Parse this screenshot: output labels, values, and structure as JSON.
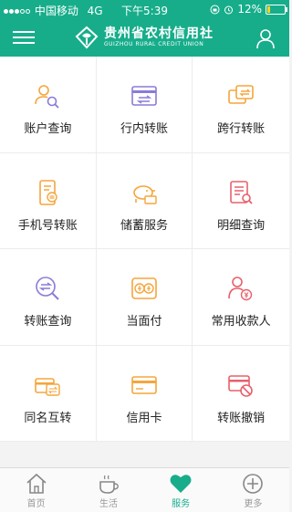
{
  "status_bar": {
    "carrier": "中国移动",
    "network": "4G",
    "time": "下午5:39",
    "battery": "12%"
  },
  "header": {
    "brand_cn": "贵州省农村信用社",
    "brand_en": "GUIZHOU RURAL CREDIT UNION"
  },
  "colors": {
    "primary": "#17ad8b",
    "orange": "#f5a53b",
    "purple": "#8a7bd8",
    "red": "#e8606c"
  },
  "services": [
    {
      "label": "账户查询",
      "icon": "account-search-icon"
    },
    {
      "label": "行内转账",
      "icon": "intra-transfer-icon"
    },
    {
      "label": "跨行转账",
      "icon": "inter-transfer-icon"
    },
    {
      "label": "手机号转账",
      "icon": "phone-transfer-icon"
    },
    {
      "label": "储蓄服务",
      "icon": "piggy-bank-icon"
    },
    {
      "label": "明细查询",
      "icon": "details-icon"
    },
    {
      "label": "转账查询",
      "icon": "transfer-query-icon"
    },
    {
      "label": "当面付",
      "icon": "face-pay-icon"
    },
    {
      "label": "常用收款人",
      "icon": "payee-icon"
    },
    {
      "label": "同名互转",
      "icon": "same-name-transfer-icon"
    },
    {
      "label": "信用卡",
      "icon": "credit-card-icon"
    },
    {
      "label": "转账撤销",
      "icon": "transfer-cancel-icon"
    }
  ],
  "tabs": [
    {
      "label": "首页",
      "icon": "home-icon",
      "active": false
    },
    {
      "label": "生活",
      "icon": "cup-icon",
      "active": false
    },
    {
      "label": "服务",
      "icon": "heart-icon",
      "active": true
    },
    {
      "label": "更多",
      "icon": "plus-circle-icon",
      "active": false
    }
  ]
}
